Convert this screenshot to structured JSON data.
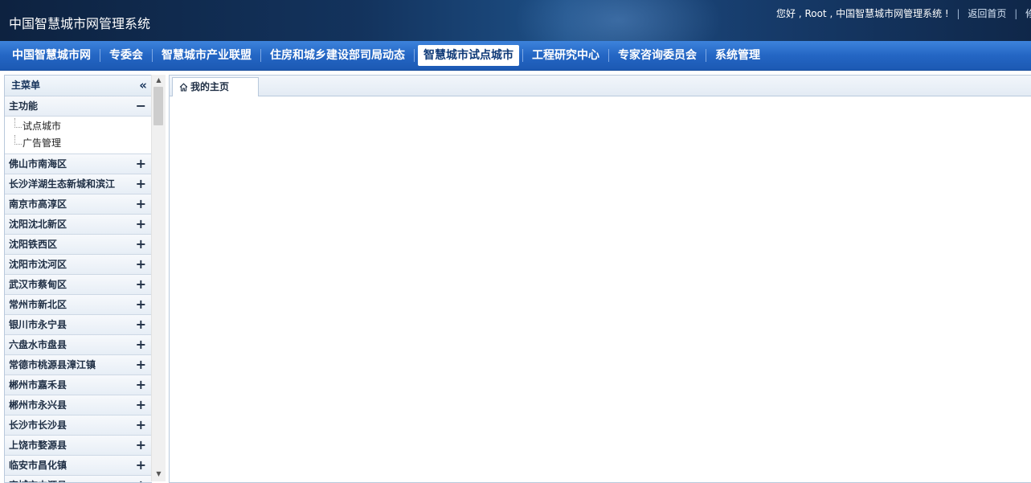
{
  "header": {
    "app_title": "中国智慧城市网管理系统",
    "greeting": "您好 , Root , 中国智慧城市网管理系统 !",
    "home_link": "返回首页",
    "edit_link": "修改"
  },
  "nav": {
    "items": [
      {
        "label": "中国智慧城市网"
      },
      {
        "label": "专委会"
      },
      {
        "label": "智慧城市产业联盟"
      },
      {
        "label": "住房和城乡建设部司局动态"
      },
      {
        "label": "智慧城市试点城市"
      },
      {
        "label": "工程研究中心"
      },
      {
        "label": "专家咨询委员会"
      },
      {
        "label": "系统管理"
      }
    ],
    "active_index": 4
  },
  "sidebar": {
    "title": "主菜单",
    "collapse_icon": "double-chevron-left",
    "main_group": {
      "label": "主功能",
      "toggle": "−",
      "children": [
        "试点城市",
        "广告管理"
      ]
    },
    "groups": [
      {
        "label": "佛山市南海区",
        "toggle": "+"
      },
      {
        "label": "长沙洋湖生态新城和滨江",
        "toggle": "+"
      },
      {
        "label": "南京市高淳区",
        "toggle": "+"
      },
      {
        "label": "沈阳沈北新区",
        "toggle": "+"
      },
      {
        "label": "沈阳铁西区",
        "toggle": "+"
      },
      {
        "label": "沈阳市沈河区",
        "toggle": "+"
      },
      {
        "label": "武汉市蔡甸区",
        "toggle": "+"
      },
      {
        "label": "常州市新北区",
        "toggle": "+"
      },
      {
        "label": "银川市永宁县",
        "toggle": "+"
      },
      {
        "label": "六盘水市盘县",
        "toggle": "+"
      },
      {
        "label": "常德市桃源县漳江镇",
        "toggle": "+"
      },
      {
        "label": "郴州市嘉禾县",
        "toggle": "+"
      },
      {
        "label": "郴州市永兴县",
        "toggle": "+"
      },
      {
        "label": "长沙市长沙县",
        "toggle": "+"
      },
      {
        "label": "上饶市婺源县",
        "toggle": "+"
      },
      {
        "label": "临安市昌化镇",
        "toggle": "+"
      },
      {
        "label": "宜城市中源县",
        "toggle": "+"
      }
    ]
  },
  "main": {
    "tab_label": "我的主页",
    "tab_icon": "home-icon"
  },
  "colors": {
    "nav_blue": "#2466c4",
    "header_dark": "#0d2240",
    "active_tab_text": "#0f3a78"
  }
}
